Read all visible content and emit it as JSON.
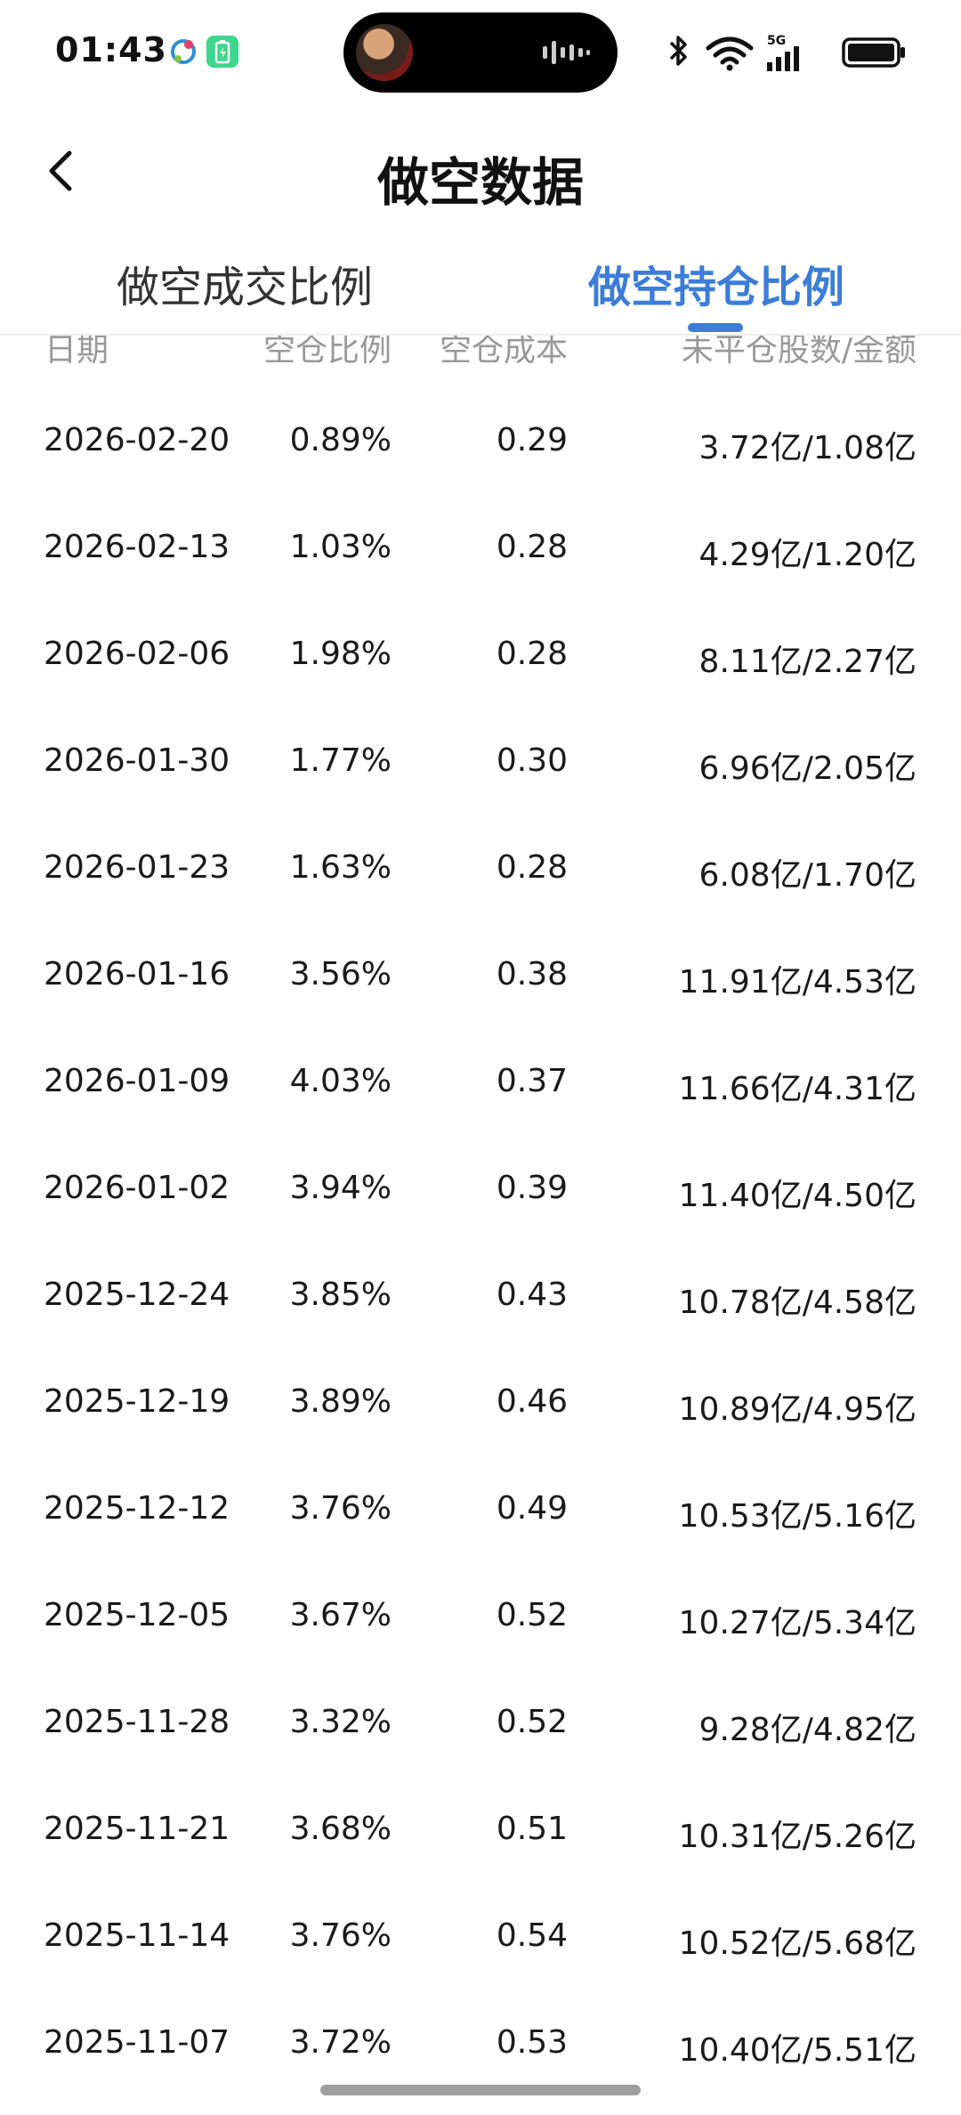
{
  "status_bar": {
    "time": "01:43",
    "network": "5G",
    "icons": [
      "mobile-carrier-icon",
      "battery-saver-icon",
      "bluetooth-icon",
      "wifi-icon",
      "signal-icon",
      "battery-icon"
    ]
  },
  "header": {
    "title": "做空数据",
    "back_icon": "chevron-left-icon"
  },
  "tabs": [
    {
      "label": "做空成交比例",
      "active": false
    },
    {
      "label": "做空持仓比例",
      "active": true
    }
  ],
  "colors": {
    "accent": "#3b7dd8",
    "header_text": "#999999"
  },
  "table": {
    "columns": [
      "日期",
      "空仓比例",
      "空仓成本",
      "未平仓股数/金额"
    ],
    "rows": [
      {
        "date": "2026-02-20",
        "ratio": "0.89%",
        "cost": "0.29",
        "amount": "3.72亿/1.08亿"
      },
      {
        "date": "2026-02-13",
        "ratio": "1.03%",
        "cost": "0.28",
        "amount": "4.29亿/1.20亿"
      },
      {
        "date": "2026-02-06",
        "ratio": "1.98%",
        "cost": "0.28",
        "amount": "8.11亿/2.27亿"
      },
      {
        "date": "2026-01-30",
        "ratio": "1.77%",
        "cost": "0.30",
        "amount": "6.96亿/2.05亿"
      },
      {
        "date": "2026-01-23",
        "ratio": "1.63%",
        "cost": "0.28",
        "amount": "6.08亿/1.70亿"
      },
      {
        "date": "2026-01-16",
        "ratio": "3.56%",
        "cost": "0.38",
        "amount": "11.91亿/4.53亿"
      },
      {
        "date": "2026-01-09",
        "ratio": "4.03%",
        "cost": "0.37",
        "amount": "11.66亿/4.31亿"
      },
      {
        "date": "2026-01-02",
        "ratio": "3.94%",
        "cost": "0.39",
        "amount": "11.40亿/4.50亿"
      },
      {
        "date": "2025-12-24",
        "ratio": "3.85%",
        "cost": "0.43",
        "amount": "10.78亿/4.58亿"
      },
      {
        "date": "2025-12-19",
        "ratio": "3.89%",
        "cost": "0.46",
        "amount": "10.89亿/4.95亿"
      },
      {
        "date": "2025-12-12",
        "ratio": "3.76%",
        "cost": "0.49",
        "amount": "10.53亿/5.16亿"
      },
      {
        "date": "2025-12-05",
        "ratio": "3.67%",
        "cost": "0.52",
        "amount": "10.27亿/5.34亿"
      },
      {
        "date": "2025-11-28",
        "ratio": "3.32%",
        "cost": "0.52",
        "amount": "9.28亿/4.82亿"
      },
      {
        "date": "2025-11-21",
        "ratio": "3.68%",
        "cost": "0.51",
        "amount": "10.31亿/5.26亿"
      },
      {
        "date": "2025-11-14",
        "ratio": "3.76%",
        "cost": "0.54",
        "amount": "10.52亿/5.68亿"
      },
      {
        "date": "2025-11-07",
        "ratio": "3.72%",
        "cost": "0.53",
        "amount": "10.40亿/5.51亿"
      }
    ]
  }
}
